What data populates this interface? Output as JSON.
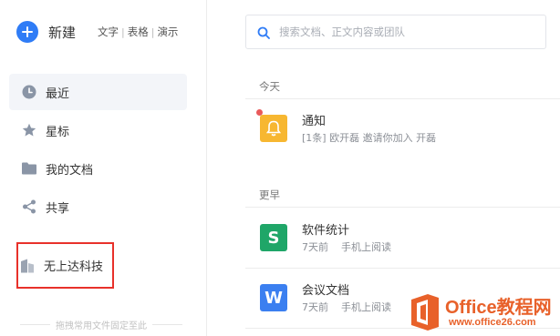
{
  "sidebar": {
    "new_label": "新建",
    "new_types": [
      "文字",
      "表格",
      "演示"
    ],
    "items": [
      {
        "label": "最近",
        "icon": "clock-icon",
        "active": true
      },
      {
        "label": "星标",
        "icon": "star-icon"
      },
      {
        "label": "我的文档",
        "icon": "folder-icon"
      },
      {
        "label": "共享",
        "icon": "share-icon"
      }
    ],
    "team_label": "无上达科技",
    "team_icon": "team-building-icon",
    "pin_hint": "拖拽常用文件固定至此"
  },
  "search": {
    "placeholder": "搜索文档、正文内容或团队"
  },
  "main": {
    "sections": [
      {
        "label": "今天",
        "items": [
          {
            "title": "通知",
            "subtitle": "[1条] 欧开磊 邀请你加入 开磊",
            "icon": "bell-icon",
            "icon_color": "#f7b731",
            "unread": true
          }
        ]
      },
      {
        "label": "更早",
        "items": [
          {
            "title": "软件统计",
            "subtitle": "7天前    手机上阅读",
            "icon": "spreadsheet-icon",
            "icon_letter": "S",
            "icon_color": "#1fa668"
          },
          {
            "title": "会议文档",
            "subtitle": "7天前    手机上阅读",
            "icon": "word-doc-icon",
            "icon_letter": "W",
            "icon_color": "#3b7ff0"
          }
        ]
      }
    ]
  },
  "watermark": {
    "title": "Office教程网",
    "url": "www.office26.com"
  },
  "colors": {
    "accent": "#2f7cf6",
    "highlight_box": "#e8312a",
    "watermark": "#e8612a"
  }
}
